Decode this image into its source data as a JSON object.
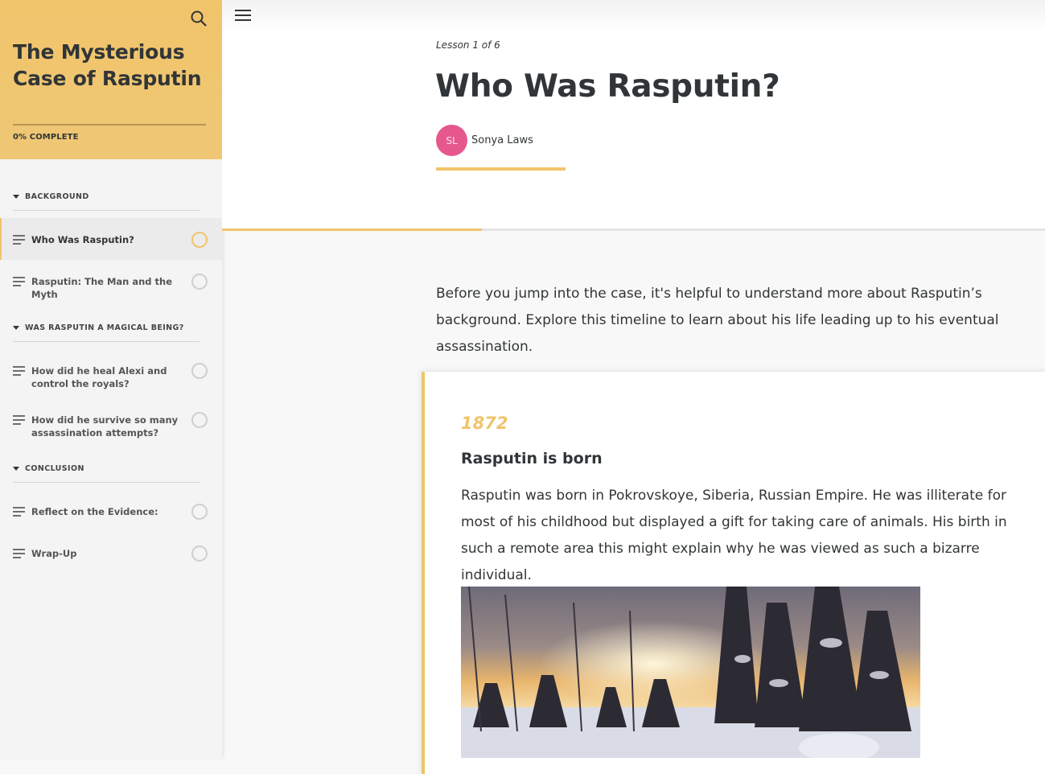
{
  "course": {
    "title": "The Mysterious Case of Rasputin",
    "progress_label": "0% COMPLETE",
    "progress_fraction": 0.0
  },
  "sidebar": {
    "sections": [
      {
        "label": "BACKGROUND",
        "lessons": [
          {
            "label": "Who Was Rasputin?",
            "active": true
          },
          {
            "label": "Rasputin: The Man and the Myth",
            "active": false
          }
        ]
      },
      {
        "label": "WAS RASPUTIN A MAGICAL BEING?",
        "lessons": [
          {
            "label": "How did he heal Alexi and control the royals?",
            "active": false
          },
          {
            "label": "How did he survive so many assassination attempts?",
            "active": false
          }
        ]
      },
      {
        "label": "CONCLUSION",
        "lessons": [
          {
            "label": "Reflect on the Evidence:",
            "active": false
          },
          {
            "label": "Wrap-Up",
            "active": false
          }
        ]
      }
    ]
  },
  "lesson": {
    "count": "Lesson 1 of 6",
    "title": "Who Was Rasputin?",
    "author_initials": "SL",
    "author_name": "Sonya Laws",
    "progress_fraction": 0.5,
    "intro": "Before you jump into the case, it's helpful to understand more about Rasputin’s background. Explore this timeline to learn about his life leading up to his eventual assassination."
  },
  "timeline": {
    "date": "1872",
    "title": "Rasputin is born",
    "body": "Rasputin was born in Pokrovskoye, Siberia, Russian Empire. He was illiterate for most of his childhood but displayed a gift for taking care of animals.  His birth in such a remote area this might explain why he was viewed as such a bizarre individual."
  },
  "colors": {
    "accent": "#f0c46a",
    "avatar": "#e6578e",
    "text": "#313537"
  },
  "icons": {
    "search": "search-icon",
    "menu": "hamburger-menu-icon",
    "lesson": "text-lines-icon",
    "section_toggle": "caret-down-icon",
    "status": "circle-status-icon"
  }
}
